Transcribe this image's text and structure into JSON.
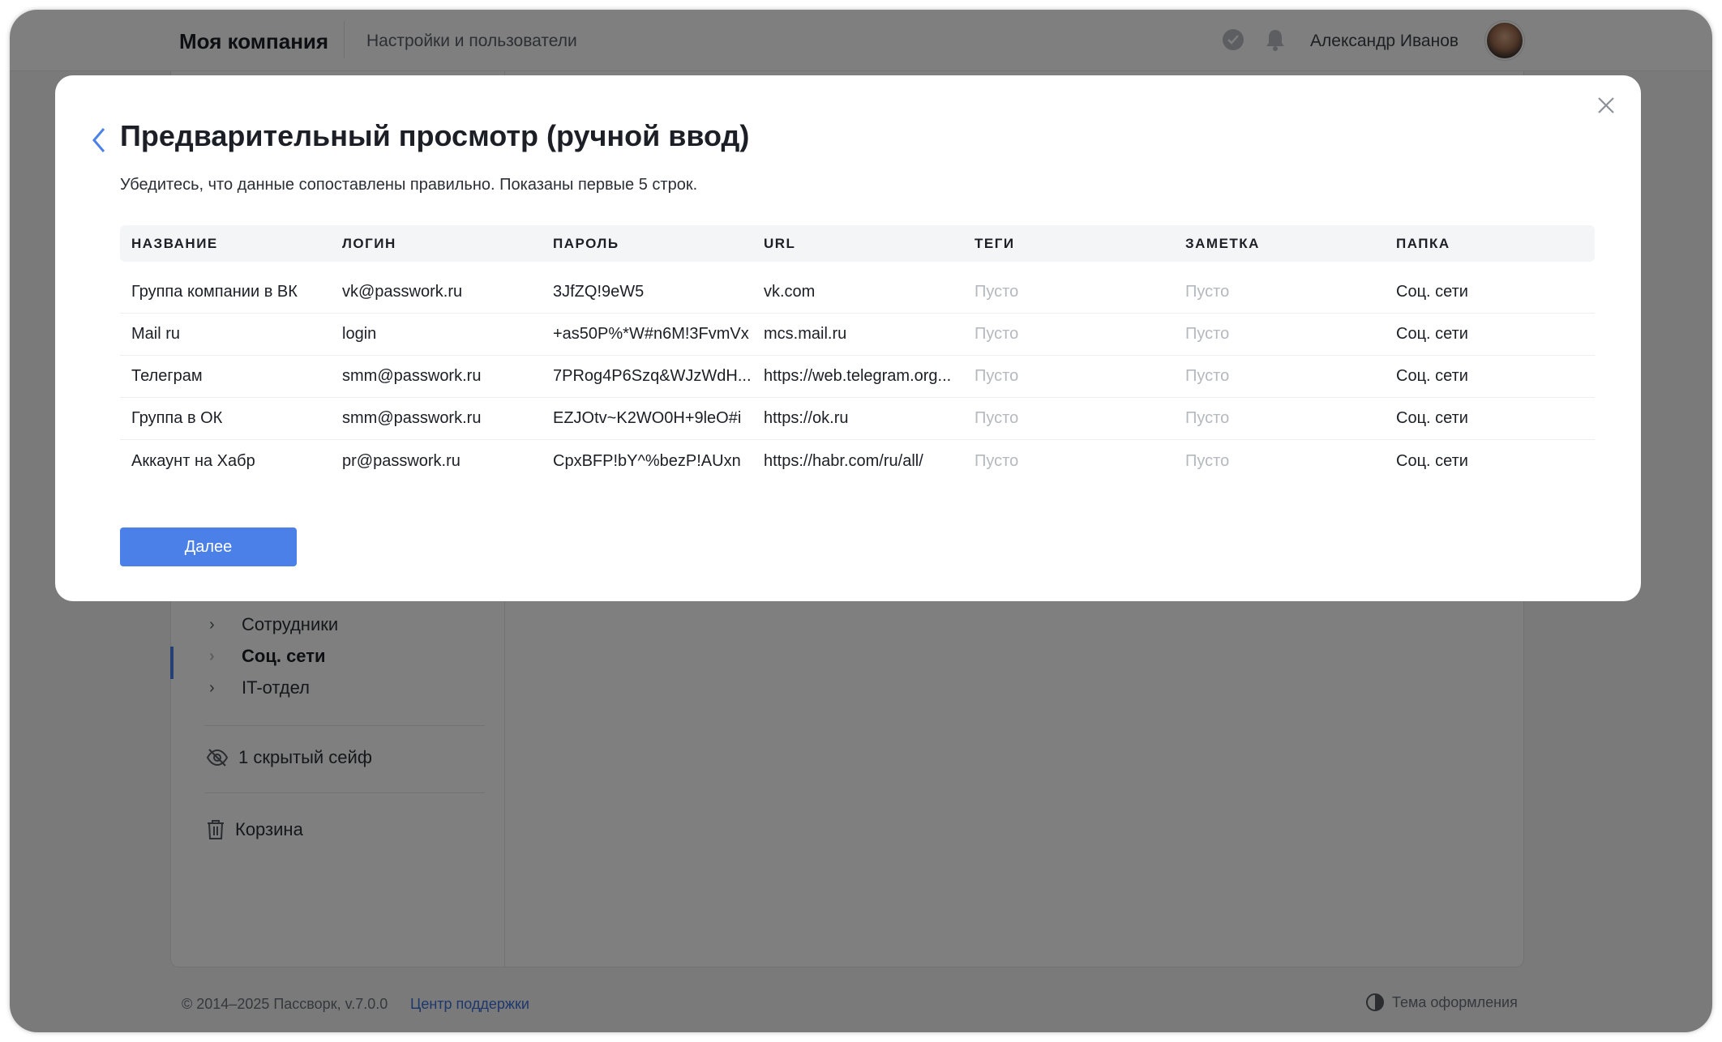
{
  "header": {
    "company": "Моя компания",
    "section": "Настройки и пользователи",
    "user_name": "Александр Иванов"
  },
  "sidebar": {
    "folders": [
      {
        "label": "Сотрудники",
        "active": false
      },
      {
        "label": "Соц. сети",
        "active": true
      },
      {
        "label": "IT-отдел",
        "active": false
      }
    ],
    "hidden_safes": "1 скрытый сейф",
    "trash": "Корзина"
  },
  "footer": {
    "copyright": "© 2014–2025 Пассворк, v.7.0.0",
    "support": "Центр поддержки",
    "theme": "Тема оформления"
  },
  "modal": {
    "title": "Предварительный просмотр (ручной ввод)",
    "subtitle": "Убедитесь, что данные сопоставлены правильно. Показаны первые 5 строк.",
    "columns": [
      "НАЗВАНИЕ",
      "ЛОГИН",
      "ПАРОЛЬ",
      "URL",
      "ТЕГИ",
      "ЗАМЕТКА",
      "ПАПКА"
    ],
    "rows": [
      [
        "Группа компании в ВК",
        "vk@passwork.ru",
        "3JfZQ!9eW5",
        "vk.com",
        "Пусто",
        "Пусто",
        "Соц. сети"
      ],
      [
        "Mail ru",
        "login",
        "+as50P%*W#n6M!3FvmVx",
        "mcs.mail.ru",
        "Пусто",
        "Пусто",
        "Соц. сети"
      ],
      [
        "Телеграм",
        "smm@passwork.ru",
        "7PRog4P6Szq&WJzWdH...",
        "https://web.telegram.org...",
        "Пусто",
        "Пусто",
        "Соц. сети"
      ],
      [
        "Группа в ОК",
        "smm@passwork.ru",
        "EZJOtv~K2WO0H+9leO#i",
        "https://ok.ru",
        "Пусто",
        "Пусто",
        "Соц. сети"
      ],
      [
        "Аккаунт на Хабр",
        "pr@passwork.ru",
        "CpxBFP!bY^%bezP!AUxn",
        "https://habr.com/ru/all/",
        "Пусто",
        "Пусто",
        "Соц. сети"
      ]
    ],
    "next_label": "Далее"
  },
  "colors": {
    "accent": "#4a80e8",
    "empty_text": "#b4b8bf",
    "overlay": "rgba(0,0,0,0.5)"
  }
}
